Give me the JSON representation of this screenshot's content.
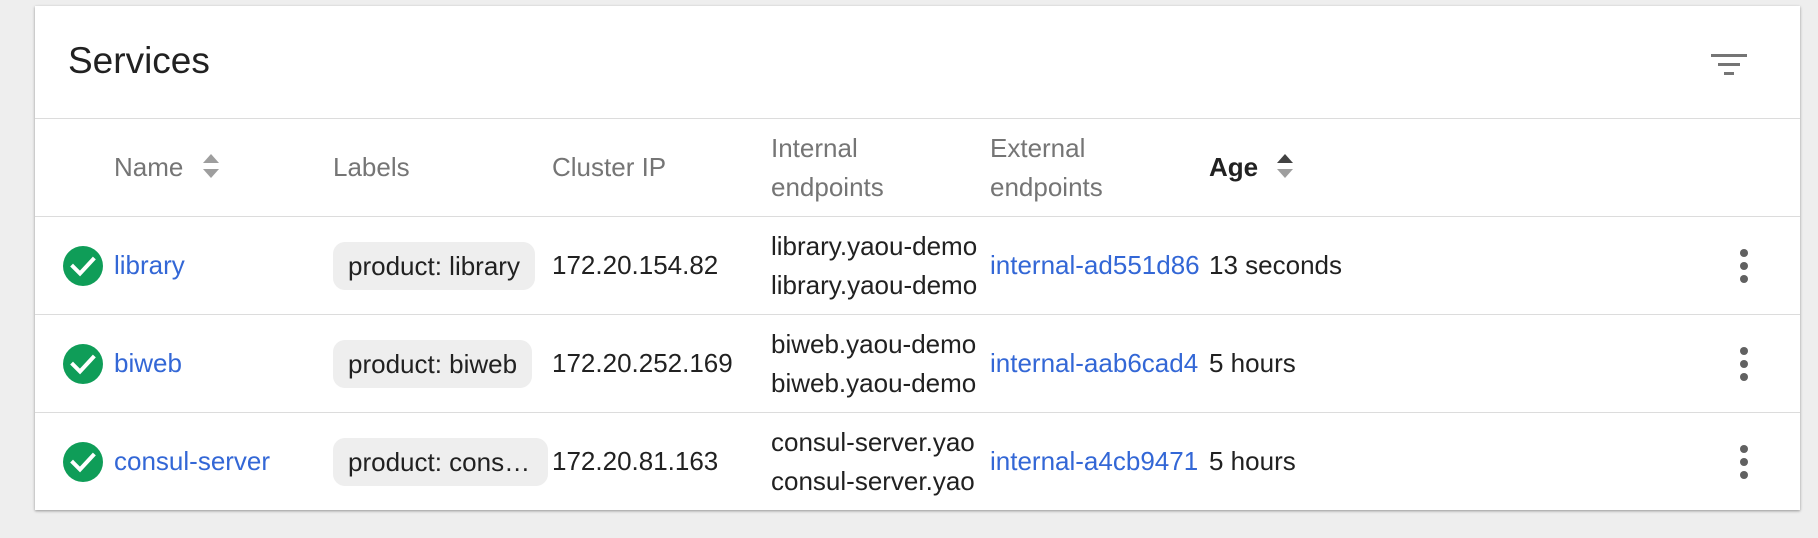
{
  "card": {
    "title": "Services"
  },
  "icons": {
    "filter": "filter-list-icon",
    "status_ok": "check-circle-icon",
    "sort": "sort-icon",
    "row_menu": "more-vertical-icon"
  },
  "colors": {
    "link": "#3367d6",
    "status_ok": "#0f9d58"
  },
  "table": {
    "headers": {
      "name": "Name",
      "labels": "Labels",
      "cluster_ip": "Cluster IP",
      "internal_line1": "Internal",
      "internal_line2": "endpoints",
      "external_line1": "External",
      "external_line2": "endpoints",
      "age": "Age"
    },
    "rows": [
      {
        "status": "ok",
        "name": "library",
        "label": "product: library",
        "cluster_ip": "172.20.154.82",
        "internal_1": "library.yaou-demo",
        "internal_2": "library.yaou-demo",
        "external": "internal-ad551d86",
        "age": "13 seconds"
      },
      {
        "status": "ok",
        "name": "biweb",
        "label": "product: biweb",
        "cluster_ip": "172.20.252.169",
        "internal_1": "biweb.yaou-demo",
        "internal_2": "biweb.yaou-demo",
        "external": "internal-aab6cad4",
        "age": "5 hours"
      },
      {
        "status": "ok",
        "name": "consul-server",
        "label": "product: consul...",
        "cluster_ip": "172.20.81.163",
        "internal_1": "consul-server.yao",
        "internal_2": "consul-server.yao",
        "external": "internal-a4cb9471",
        "age": "5 hours"
      }
    ]
  }
}
